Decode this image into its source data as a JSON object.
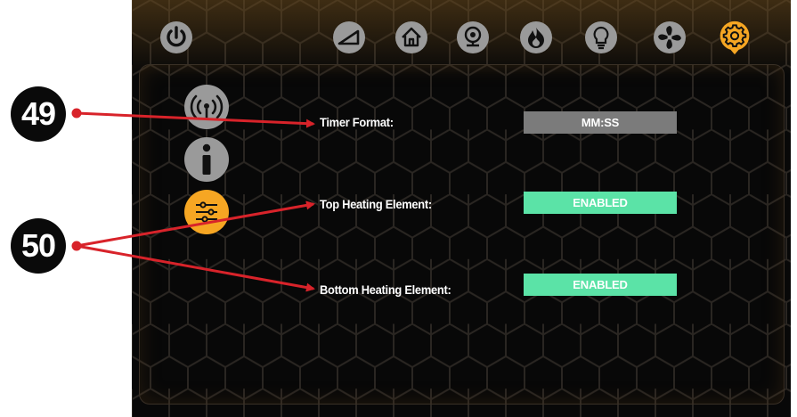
{
  "topbar": {
    "icons": [
      "power-icon",
      "ramp-icon",
      "home-icon",
      "webcam-icon",
      "flame-icon",
      "lightbulb-icon",
      "fan-icon",
      "settings-gear-icon"
    ],
    "active_icon": "settings-gear-icon"
  },
  "sidebar": {
    "items": [
      {
        "icon": "wireless-signal-icon",
        "active": false
      },
      {
        "icon": "info-icon",
        "active": false
      },
      {
        "icon": "sliders-icon",
        "active": true
      }
    ]
  },
  "settings": [
    {
      "label": "Timer Format:",
      "value": "MM:SS",
      "state": "neutral"
    },
    {
      "label": "Top Heating Element:",
      "value": "ENABLED",
      "state": "enabled"
    },
    {
      "label": "Bottom Heating Element:",
      "value": "ENABLED",
      "state": "enabled"
    }
  ],
  "callouts": [
    {
      "number": "49"
    },
    {
      "number": "50"
    }
  ],
  "colors": {
    "accent_orange": "#f6a623",
    "enabled_green": "#5be3a7",
    "neutral_gray": "#7b7b7b",
    "arrow_red": "#d8232a",
    "screen_bg": "#080808"
  }
}
